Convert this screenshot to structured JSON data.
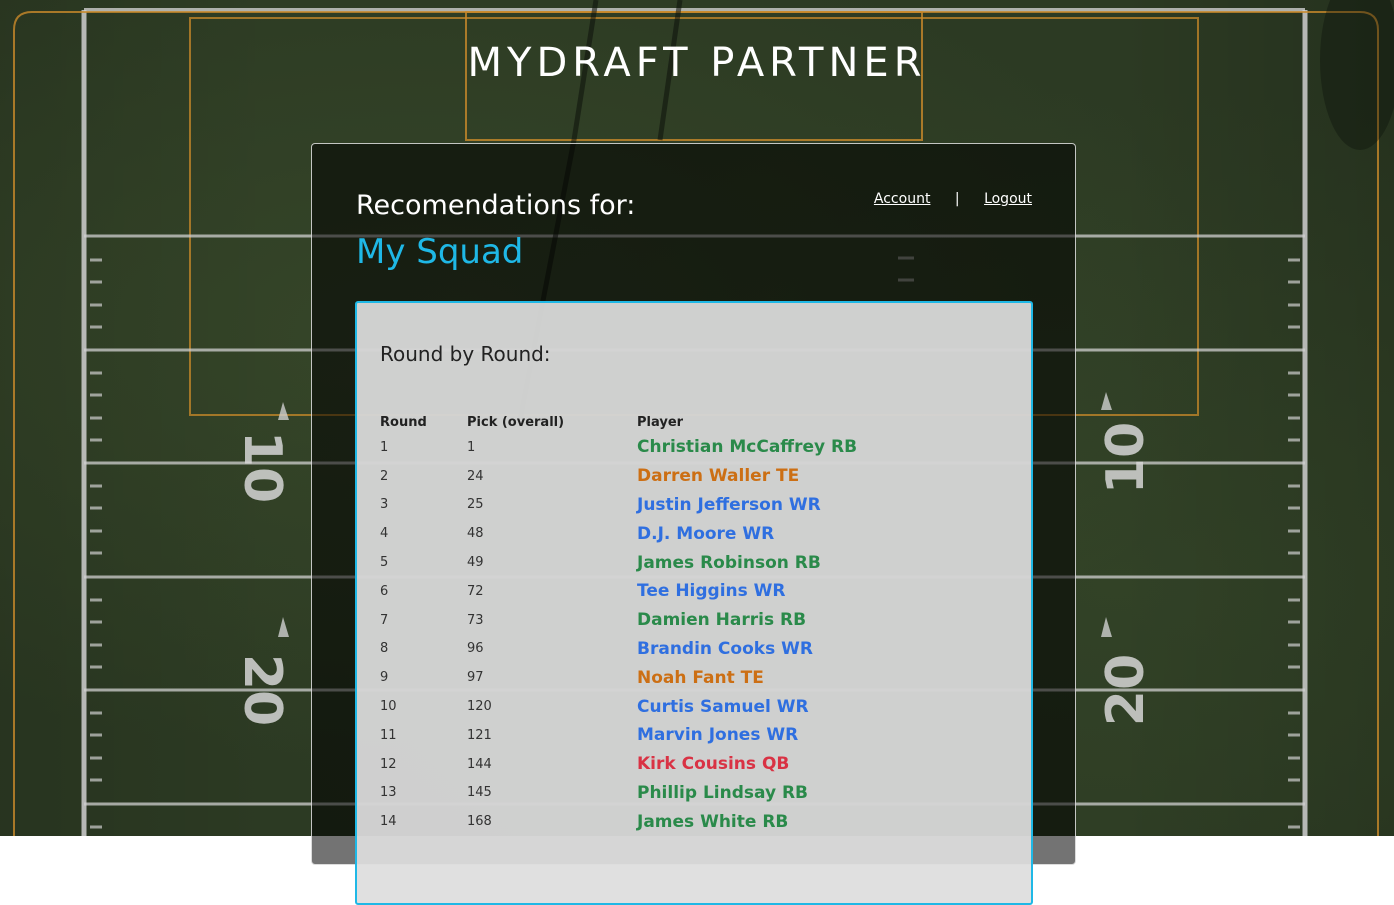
{
  "site": {
    "title": "MYDRAFT PARTNER"
  },
  "nav": {
    "account_label": "Account",
    "separator": "|",
    "logout_label": "Logout"
  },
  "heading": {
    "recommendations_label": "Recomendations for:",
    "squad_name": "My Squad"
  },
  "round_by_round": {
    "title": "Round by Round:",
    "columns": [
      "Round",
      "Pick (overall)",
      "Player"
    ],
    "rows": [
      {
        "round": "1",
        "pick": "1",
        "player": "Christian McCaffrey RB",
        "position": "RB"
      },
      {
        "round": "2",
        "pick": "24",
        "player": "Darren Waller TE",
        "position": "TE"
      },
      {
        "round": "3",
        "pick": "25",
        "player": "Justin Jefferson WR",
        "position": "WR"
      },
      {
        "round": "4",
        "pick": "48",
        "player": "D.J. Moore WR",
        "position": "WR"
      },
      {
        "round": "5",
        "pick": "49",
        "player": "James Robinson RB",
        "position": "RB"
      },
      {
        "round": "6",
        "pick": "72",
        "player": "Tee Higgins WR",
        "position": "WR"
      },
      {
        "round": "7",
        "pick": "73",
        "player": "Damien Harris RB",
        "position": "RB"
      },
      {
        "round": "8",
        "pick": "96",
        "player": "Brandin Cooks WR",
        "position": "WR"
      },
      {
        "round": "9",
        "pick": "97",
        "player": "Noah Fant TE",
        "position": "TE"
      },
      {
        "round": "10",
        "pick": "120",
        "player": "Curtis Samuel WR",
        "position": "WR"
      },
      {
        "round": "11",
        "pick": "121",
        "player": "Marvin Jones WR",
        "position": "WR"
      },
      {
        "round": "12",
        "pick": "144",
        "player": "Kirk Cousins QB",
        "position": "QB"
      },
      {
        "round": "13",
        "pick": "145",
        "player": "Phillip Lindsay RB",
        "position": "RB"
      },
      {
        "round": "14",
        "pick": "168",
        "player": "James White RB",
        "position": "RB"
      }
    ]
  },
  "field_markings": {
    "left_numbers": [
      "10",
      "20"
    ],
    "right_numbers": [
      "10",
      "20"
    ]
  },
  "colors": {
    "accent": "#1fb8e6",
    "RB": "#2a8a4a",
    "WR": "#2f6fe0",
    "TE": "#cc6f14",
    "QB": "#d93244"
  }
}
